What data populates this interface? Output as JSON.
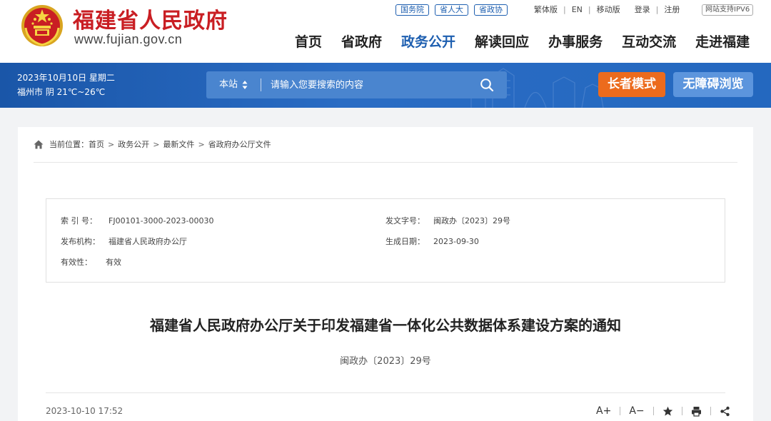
{
  "header": {
    "site_name": "福建省人民政府",
    "site_url": "www.fujian.gov.cn",
    "badges": [
      "国务院",
      "省人大",
      "省政协"
    ],
    "links": [
      "繁体版",
      "EN",
      "移动版"
    ],
    "auth_links": [
      "登录",
      "注册"
    ],
    "ipv6_badge": "网站支持IPV6",
    "nav": [
      "首页",
      "省政府",
      "政务公开",
      "解读回应",
      "办事服务",
      "互动交流",
      "走进福建"
    ],
    "active_nav": "政务公开",
    "brand_color": "#c91e23"
  },
  "banner": {
    "date": "2023年10月10日 星期二",
    "weather": "福州市 阴 21℃~26℃",
    "search_scope": "本站",
    "search_placeholder": "请输入您要搜索的内容",
    "elder_mode": "长者模式",
    "accessible_mode": "无障碍浏览",
    "bg_color": "#1a56a8",
    "elder_color": "#ec6b1d"
  },
  "breadcrumb": {
    "label": "当前位置：",
    "items": [
      "首页",
      "政务公开",
      "最新文件",
      "省政府办公厅文件"
    ]
  },
  "meta": {
    "index_no_label": "索 引 号：",
    "index_no": "FJ00101-3000-2023-00030",
    "doc_no_label": "发文字号：",
    "doc_no": "闽政办〔2023〕29号",
    "issuer_label": "发布机构：",
    "issuer": "福建省人民政府办公厅",
    "date_label": "生成日期：",
    "date": "2023-09-30",
    "validity_label": "有效性：",
    "validity": "有效"
  },
  "document": {
    "title": "福建省人民政府办公厅关于印发福建省一体化公共数据体系建设方案的通知",
    "number": "闽政办〔2023〕29号",
    "publish_time": "2023-10-10 17:52"
  },
  "tools": {
    "font_larger": "A+",
    "font_smaller": "A−"
  }
}
